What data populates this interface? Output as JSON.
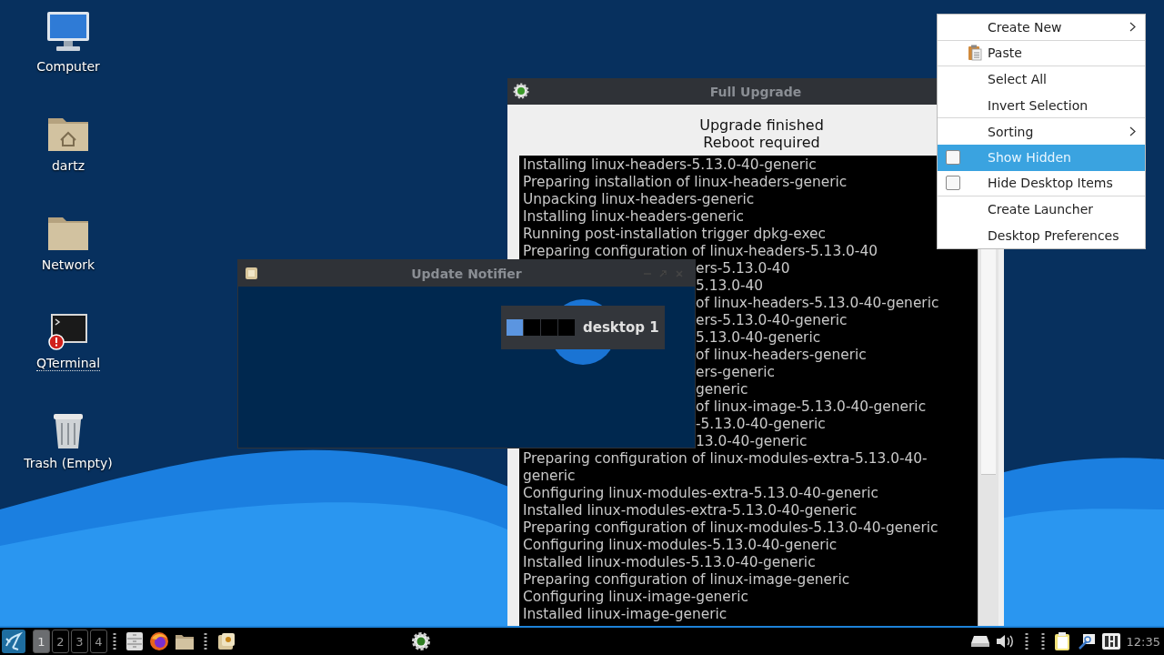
{
  "desktop_icons": [
    {
      "label": "Computer",
      "kind": "computer",
      "focused": false
    },
    {
      "label": "dartz",
      "kind": "home",
      "focused": false
    },
    {
      "label": "Network",
      "kind": "folder",
      "focused": false
    },
    {
      "label": "QTerminal",
      "kind": "terminal",
      "focused": true
    },
    {
      "label": "Trash (Empty)",
      "kind": "trash",
      "focused": false
    }
  ],
  "full_upgrade": {
    "title": "Full Upgrade",
    "status": [
      "Upgrade finished",
      "Reboot required"
    ],
    "log_above_notifier": [
      "Installing linux-headers-5.13.0-40-generic",
      "Preparing installation of linux-headers-generic",
      "Unpacking linux-headers-generic",
      "Installing linux-headers-generic",
      "Running post-installation trigger dpkg-exec",
      "Preparing configuration of linux-headers-5.13.0-40"
    ],
    "log_beside_notifier": [
      "ers-5.13.0-40",
      "5.13.0-40",
      "of linux-headers-5.13.0-40-generic",
      "ers-5.13.0-40-generic",
      "5.13.0-40-generic",
      "of linux-headers-generic",
      "ers-generic",
      "generic",
      "of linux-image-5.13.0-40-generic",
      "-5.13.0-40-generic",
      "13.0-40-generic"
    ],
    "log_below_notifier": [
      "Preparing configuration of linux-modules-extra-5.13.0-40-generic",
      "Configuring linux-modules-extra-5.13.0-40-generic",
      "Installed linux-modules-extra-5.13.0-40-generic",
      "Preparing configuration of linux-modules-5.13.0-40-generic",
      "Configuring linux-modules-5.13.0-40-generic",
      "Installed linux-modules-5.13.0-40-generic",
      "Preparing configuration of linux-image-generic",
      "Configuring linux-image-generic",
      "Installed linux-image-generic"
    ]
  },
  "update_notifier": {
    "title": "Update Notifier"
  },
  "desktop_switcher": {
    "label": "desktop 1",
    "desktops": [
      {
        "selected": true
      },
      {
        "selected": false
      },
      {
        "selected": false
      },
      {
        "selected": false
      }
    ]
  },
  "context_menu": {
    "items": [
      {
        "label": "Create New",
        "kind": "submenu",
        "selected": false,
        "separator_after": true
      },
      {
        "label": "Paste",
        "kind": "icon",
        "selected": false,
        "separator_after": true
      },
      {
        "label": "Select All",
        "kind": "plain",
        "selected": false,
        "separator_after": false
      },
      {
        "label": "Invert Selection",
        "kind": "plain",
        "selected": false,
        "separator_after": true
      },
      {
        "label": "Sorting",
        "kind": "submenu",
        "selected": false,
        "separator_after": false
      },
      {
        "label": "Show Hidden",
        "kind": "checkbox",
        "checked": false,
        "selected": true,
        "separator_after": false
      },
      {
        "label": "Hide Desktop Items",
        "kind": "checkbox",
        "checked": false,
        "selected": false,
        "separator_after": true
      },
      {
        "label": "Create Launcher",
        "kind": "plain",
        "selected": false,
        "separator_after": false
      },
      {
        "label": "Desktop Preferences",
        "kind": "plain",
        "selected": false,
        "separator_after": false
      }
    ]
  },
  "taskbar": {
    "desktops": [
      {
        "label": "1",
        "selected": true
      },
      {
        "label": "2",
        "selected": false
      },
      {
        "label": "3",
        "selected": false
      },
      {
        "label": "4",
        "selected": false
      }
    ],
    "clock": "12:35"
  }
}
